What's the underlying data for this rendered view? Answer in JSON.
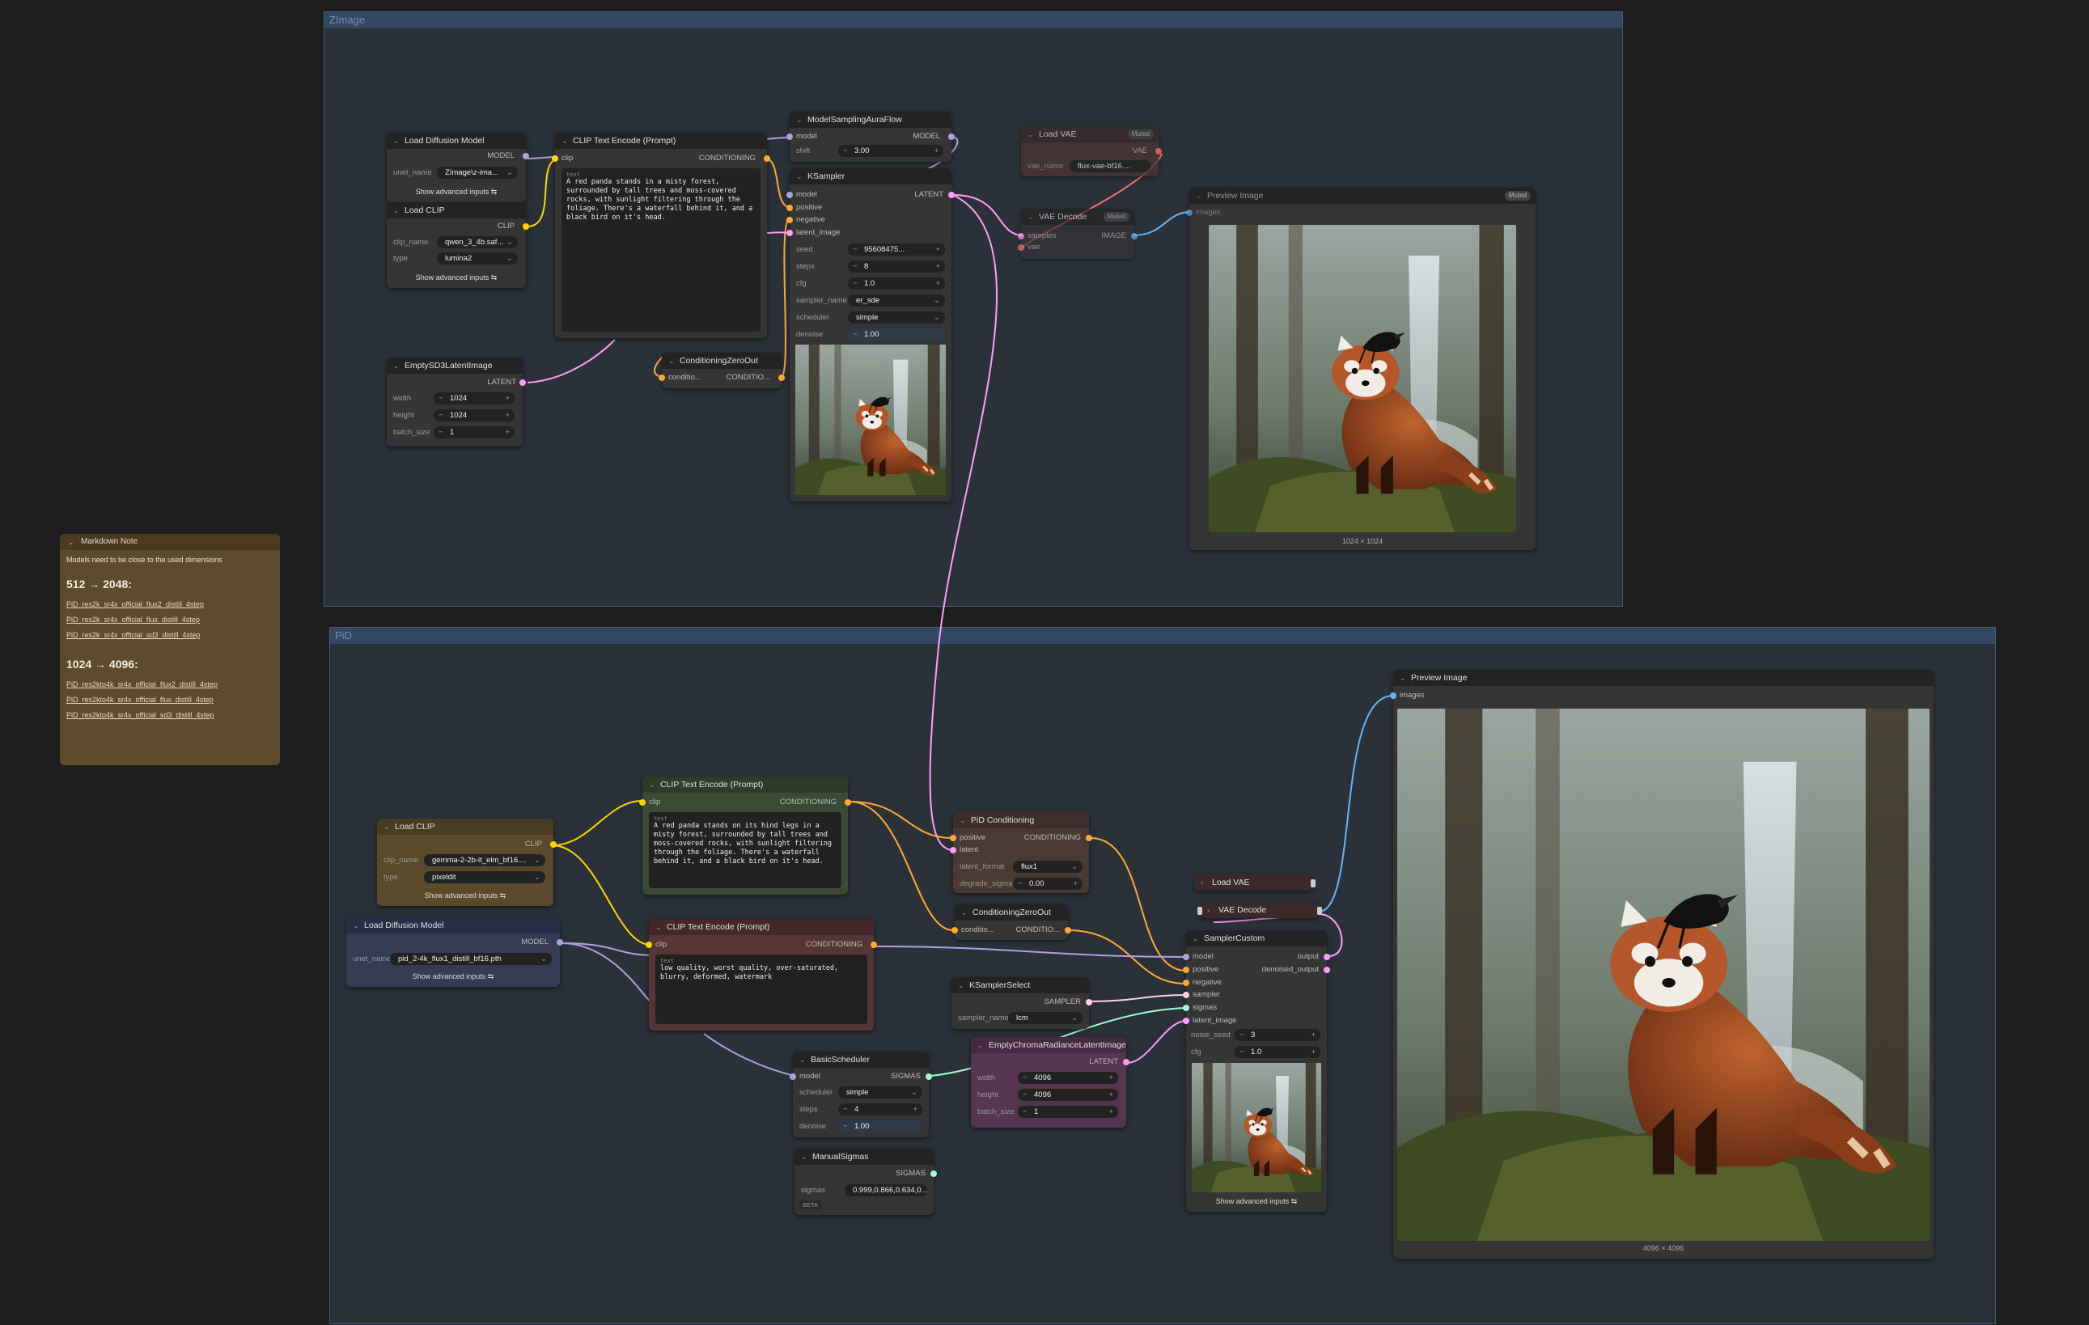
{
  "groups": {
    "zimage": {
      "title": "ZImage"
    },
    "pid": {
      "title": "PiD"
    }
  },
  "nodes": {
    "load_diffusion_1": {
      "title": "Load Diffusion Model",
      "out_model": "MODEL",
      "unet_label": "unet_name",
      "unet_value": "ZImage\\z-ima...",
      "advanced": "Show advanced inputs"
    },
    "load_clip_1": {
      "title": "Load CLIP",
      "out_clip": "CLIP",
      "clip_label": "clip_name",
      "clip_value": "qwen_3_4b.saf...",
      "type_label": "type",
      "type_value": "lumina2",
      "advanced": "Show advanced inputs"
    },
    "clip_text_1": {
      "title": "CLIP Text Encode (Prompt)",
      "in_clip": "clip",
      "out_cond": "CONDITIONING",
      "text_label": "text",
      "text": "A red panda stands in a misty forest, surrounded by tall trees and moss-covered rocks, with sunlight filtering through the foliage. There's a waterfall behind it, and a black bird on it's head."
    },
    "empty_sd3": {
      "title": "EmptySD3LatentImage",
      "out_latent": "LATENT",
      "width_label": "width",
      "width_value": "1024",
      "height_label": "height",
      "height_value": "1024",
      "batch_label": "batch_size",
      "batch_value": "1"
    },
    "cond_zero_1": {
      "title": "ConditioningZeroOut",
      "in_cond": "conditio...",
      "out_cond": "CONDITIO..."
    },
    "model_sampling": {
      "title": "ModelSamplingAuraFlow",
      "in_model": "model",
      "out_model": "MODEL",
      "shift_label": "shift",
      "shift_value": "3.00"
    },
    "ksampler": {
      "title": "KSampler",
      "in_model": "model",
      "in_positive": "positive",
      "in_negative": "negative",
      "in_latent": "latent_image",
      "out_latent": "LATENT",
      "seed_label": "seed",
      "seed_value": "95608475...",
      "steps_label": "steps",
      "steps_value": "8",
      "cfg_label": "cfg",
      "cfg_value": "1.0",
      "sampler_label": "sampler_name",
      "sampler_value": "er_sde",
      "scheduler_label": "scheduler",
      "scheduler_value": "simple",
      "denoise_label": "denoise",
      "denoise_value": "1.00"
    },
    "load_vae_1": {
      "title": "Load VAE",
      "badge": "Muted",
      "out_vae": "VAE",
      "vae_label": "vae_name",
      "vae_value": "flux-vae-bf16...."
    },
    "vae_decode_1": {
      "title": "VAE Decode",
      "badge": "Muted",
      "in_samples": "samples",
      "in_vae": "vae",
      "out_image": "IMAGE"
    },
    "preview_1": {
      "title": "Preview Image",
      "badge": "Muted",
      "in_images": "images",
      "caption": "1024 × 1024"
    },
    "markdown_note": {
      "title": "Markdown Note",
      "intro": "Models need to be close to the used dimensions",
      "heading1": "512 → 2048:",
      "links1": [
        "PiD_res2k_sr4x_official_flux2_distill_4step",
        "PiD_res2k_sr4x_official_flux_distill_4step",
        "PiD_res2k_sr4x_official_sd3_distill_4step"
      ],
      "heading2": "1024 → 4096:",
      "links2": [
        "PiD_res2kto4k_sr4x_official_flux2_distill_4step",
        "PiD_res2kto4k_sr4x_official_flux_distill_4step",
        "PiD_res2kto4k_sr4x_official_sd3_distill_4step"
      ]
    },
    "load_clip_2": {
      "title": "Load CLIP",
      "out_clip": "CLIP",
      "clip_label": "clip_name",
      "clip_value": "gemma-2-2b-it_elm_bf16....",
      "type_label": "type",
      "type_value": "pixeldit",
      "advanced": "Show advanced inputs"
    },
    "load_diffusion_2": {
      "title": "Load Diffusion Model",
      "out_model": "MODEL",
      "unet_label": "unet_name",
      "unet_value": "pid_2-4k_flux1_distill_bf16.pth",
      "advanced": "Show advanced inputs"
    },
    "clip_text_pos": {
      "title": "CLIP Text Encode (Prompt)",
      "in_clip": "clip",
      "out_cond": "CONDITIONING",
      "text_label": "text",
      "text": "A red panda stands on its hind legs in a misty forest, surrounded by tall trees and moss-covered rocks, with sunlight filtering through the foliage. There's a waterfall behind it, and a black bird on it's head."
    },
    "clip_text_neg": {
      "title": "CLIP Text Encode (Prompt)",
      "in_clip": "clip",
      "out_cond": "CONDITIONING",
      "text_label": "text",
      "text": "low quality, worst quality, over-saturated, blurry, deformed, watermark"
    },
    "pid_cond": {
      "title": "PiD Conditioning",
      "in_positive": "positive",
      "in_latent": "latent",
      "out_cond": "CONDITIONING",
      "format_label": "latent_format",
      "format_value": "flux1",
      "sigma_label": "degrade_sigma",
      "sigma_value": "0.00"
    },
    "cond_zero_2": {
      "title": "ConditioningZeroOut",
      "in_cond": "conditio...",
      "out_cond": "CONDITIO..."
    },
    "ksampler_select": {
      "title": "KSamplerSelect",
      "out_sampler": "SAMPLER",
      "sampler_label": "sampler_name",
      "sampler_value": "lcm"
    },
    "basic_scheduler": {
      "title": "BasicScheduler",
      "in_model": "model",
      "out_sigmas": "SIGMAS",
      "scheduler_label": "scheduler",
      "scheduler_value": "simple",
      "steps_label": "steps",
      "steps_value": "4",
      "denoise_label": "denoise",
      "denoise_value": "1.00"
    },
    "manual_sigmas": {
      "title": "ManualSigmas",
      "out_sigmas": "SIGMAS",
      "sigmas_label": "sigmas",
      "sigmas_value": "0.999,0.866,0.634,0....",
      "beta": "BETA"
    },
    "empty_chroma": {
      "title": "EmptyChromaRadianceLatentImage",
      "out_latent": "LATENT",
      "width_label": "width",
      "width_value": "4096",
      "height_label": "height",
      "height_value": "4096",
      "batch_label": "batch_size",
      "batch_value": "1"
    },
    "load_vae_2": {
      "title": "Load VAE"
    },
    "vae_decode_2": {
      "title": "VAE Decode"
    },
    "sampler_custom": {
      "title": "SamplerCustom",
      "in_model": "model",
      "in_positive": "positive",
      "in_negative": "negative",
      "in_sampler": "sampler",
      "in_sigmas": "sigmas",
      "in_latent": "latent_image",
      "out_output": "output",
      "out_denoised": "denoised_output",
      "seed_label": "noise_seed",
      "seed_value": "3",
      "cfg_label": "cfg",
      "cfg_value": "1.0",
      "advanced": "Show advanced inputs"
    },
    "preview_2": {
      "title": "Preview Image",
      "in_images": "images",
      "caption": "4096 × 4096"
    }
  },
  "colors": {
    "canvas": "#1e1e1e",
    "group_bg": "#2b3139",
    "group_title": "#344862",
    "model": "#b39ddb",
    "clip": "#ffd500",
    "conditioning": "#ffa931",
    "latent": "#ff9cf9",
    "vae": "#ff6e6e",
    "image": "#64b5f6",
    "sigmas": "#a0ffd0",
    "sampler": "#ffd0e0"
  }
}
